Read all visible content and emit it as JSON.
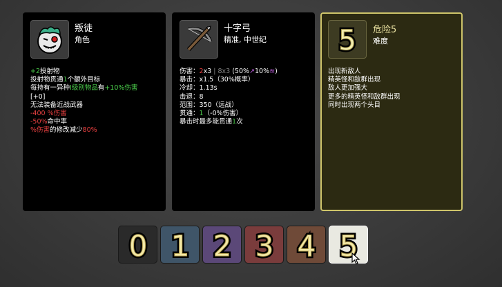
{
  "character": {
    "name": "叛徒",
    "type": "角色",
    "lines": [
      [
        {
          "t": "+2",
          "c": "g"
        },
        {
          "t": "投射物",
          "c": "w"
        }
      ],
      [
        {
          "t": "投射物贯通",
          "c": "w"
        },
        {
          "t": "1",
          "c": "g"
        },
        {
          "t": "个额外目标",
          "c": "w"
        }
      ],
      [
        {
          "t": "每持有一异种",
          "c": "w"
        },
        {
          "t": "I级别物品",
          "c": "g"
        },
        {
          "t": "有",
          "c": "w"
        },
        {
          "t": "+10%伤害",
          "c": "g"
        }
      ],
      [
        {
          "t": "[+0]",
          "c": "w"
        }
      ],
      [
        {
          "t": "无法装备近战武器",
          "c": "w"
        }
      ],
      [
        {
          "t": "-400 %伤害",
          "c": "r"
        }
      ],
      [
        {
          "t": "-50%",
          "c": "r"
        },
        {
          "t": "命中率",
          "c": "w"
        }
      ],
      [
        {
          "t": "%伤害",
          "c": "r"
        },
        {
          "t": "的修改减少",
          "c": "w"
        },
        {
          "t": "80%",
          "c": "r"
        }
      ]
    ]
  },
  "weapon": {
    "name": "十字弓",
    "tags": "精准, 中世纪",
    "lines": [
      [
        {
          "t": "伤害：",
          "c": "w"
        },
        {
          "t": "2",
          "c": "r"
        },
        {
          "t": "x3 ",
          "c": "w"
        },
        {
          "t": "| 8x3 ",
          "c": "dim"
        },
        {
          "t": "(50%",
          "c": "w"
        },
        {
          "t": "↗",
          "c": "p"
        },
        {
          "t": "10%",
          "c": "w"
        },
        {
          "t": "≋",
          "c": "p"
        },
        {
          "t": ")",
          "c": "w"
        }
      ],
      [
        {
          "t": "暴击：x1.5（30%概率）",
          "c": "w"
        }
      ],
      [
        {
          "t": "冷却：1.13s",
          "c": "w"
        }
      ],
      [
        {
          "t": "击退：8",
          "c": "w"
        }
      ],
      [
        {
          "t": "范围：350（远战）",
          "c": "w"
        }
      ],
      [
        {
          "t": "贯通：",
          "c": "w"
        },
        {
          "t": "1",
          "c": "g"
        },
        {
          "t": "（-0%伤害）",
          "c": "w"
        }
      ],
      [
        {
          "t": "暴击时最多能贯通",
          "c": "w"
        },
        {
          "t": "1",
          "c": "g"
        },
        {
          "t": "次",
          "c": "w"
        }
      ]
    ]
  },
  "danger": {
    "title": "危险5",
    "subtitle": "难度",
    "icon_digit": "5",
    "lines": [
      "出现新敌人",
      "精英怪和敌群出现",
      "敌人更加强大",
      "更多的精英怪和敌群出现",
      "同时出现两个头目"
    ]
  },
  "levels": [
    {
      "digit": "0",
      "bg": "#2a2a2a",
      "selected": false
    },
    {
      "digit": "1",
      "bg": "#3f5568",
      "selected": false
    },
    {
      "digit": "2",
      "bg": "#5b4878",
      "selected": false
    },
    {
      "digit": "3",
      "bg": "#7a3c3c",
      "selected": false
    },
    {
      "digit": "4",
      "bg": "#6f4a38",
      "selected": false
    },
    {
      "digit": "5",
      "bg": "#e9e9e1",
      "selected": true
    }
  ],
  "colors": {
    "accent": "#cfc56a",
    "positive": "#4cd04c",
    "negative": "#e84040"
  }
}
